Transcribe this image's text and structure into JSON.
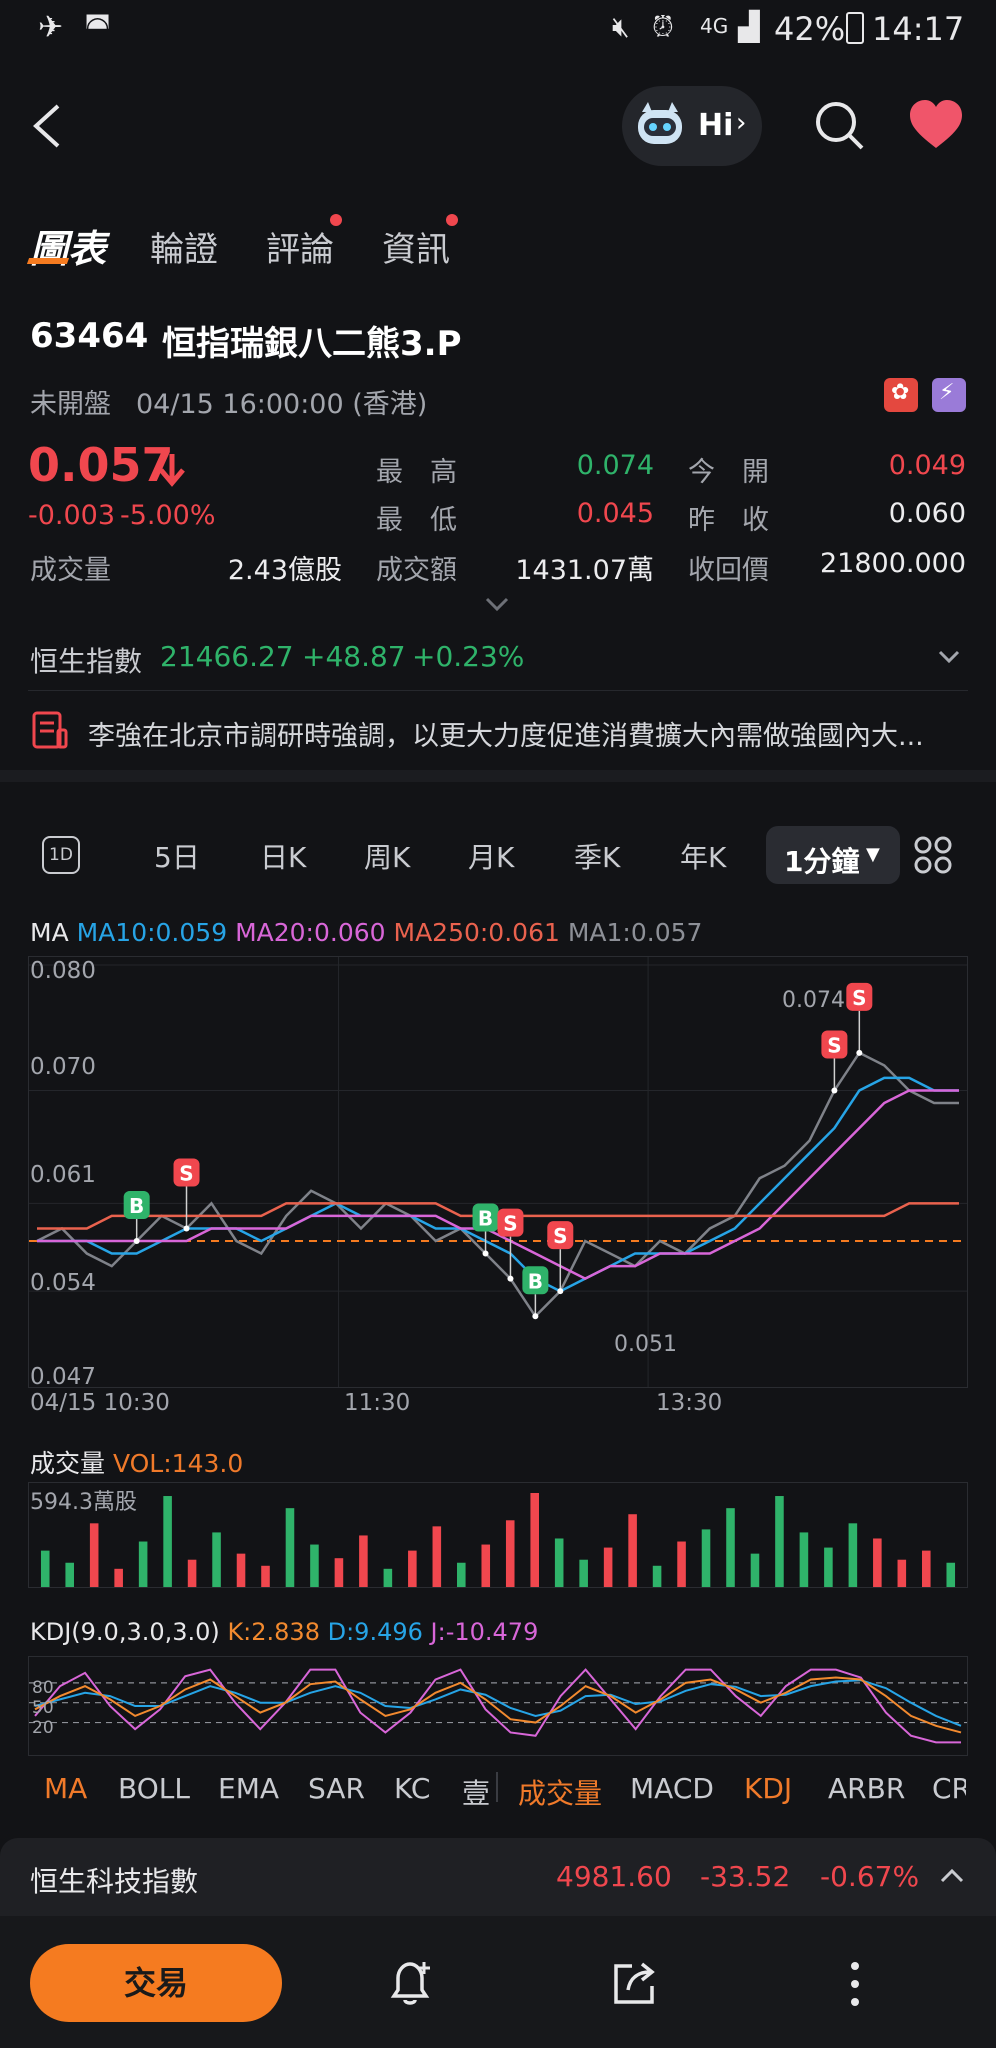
{
  "status": {
    "battery": "42%",
    "time": "14:17",
    "network": "4G"
  },
  "nav": {
    "hi_label": "Hi"
  },
  "tabs": [
    "圖表",
    "輪證",
    "評論",
    "資訊"
  ],
  "stock": {
    "code": "63464",
    "name": "恒指瑞銀八二熊3.P",
    "market_status": "未開盤",
    "datetime": "04/15 16:00:00 (香港)",
    "price": "0.057",
    "change": "-0.003",
    "change_pct": "-5.00%",
    "high_label": "最　高",
    "high": "0.074",
    "open_label": "今　開",
    "open": "0.049",
    "low_label": "最　低",
    "low": "0.045",
    "prev_label": "昨　收",
    "prev": "0.060",
    "volume_label": "成交量",
    "volume": "2.43億股",
    "turnover_label": "成交額",
    "turnover": "1431.07萬",
    "callprice_label": "收回價",
    "callprice": "21800.000"
  },
  "index": {
    "name": "恒生指數",
    "value": "21466.27",
    "change": "+48.87",
    "pct": "+0.23%"
  },
  "news": {
    "headline": "李強在北京市調研時強調，以更大力度促進消費擴大內需做強國內大..."
  },
  "periods": [
    "1D",
    "5日",
    "日K",
    "周K",
    "月K",
    "季K",
    "年K",
    "1分鐘"
  ],
  "ma_legend": {
    "ma": "MA",
    "ma10": "MA10:0.059",
    "ma20": "MA20:0.060",
    "ma250": "MA250:0.061",
    "ma1": "MA1:0.057"
  },
  "price_axis": [
    "0.080",
    "0.070",
    "0.061",
    "0.054",
    "0.047"
  ],
  "time_axis": [
    "04/15 10:30",
    "11:30",
    "13:30"
  ],
  "annotations": {
    "max_label": "0.074",
    "min_label": "0.051",
    "buy": "B",
    "sell": "S"
  },
  "volume_panel": {
    "title": "成交量",
    "vol": "VOL:143.0",
    "max": "594.3萬股"
  },
  "kdj_panel": {
    "title": "KDJ(9.0,3.0,3.0)",
    "k": "K:2.838",
    "d": "D:9.496",
    "j": "J:-10.479",
    "levels": [
      "80",
      "50",
      "20"
    ]
  },
  "indicator_tabs": [
    "MA",
    "BOLL",
    "EMA",
    "SAR",
    "KC",
    "壹",
    "成交量",
    "MACD",
    "KDJ",
    "ARBR",
    "CR"
  ],
  "bottom_index": {
    "name": "恒生科技指數",
    "value": "4981.60",
    "change": "-33.52",
    "pct": "-0.67%"
  },
  "bottom_bar": {
    "trade": "交易"
  },
  "colors": {
    "up": "#2fb36a",
    "down": "#f0474e",
    "accent": "#f57b20",
    "ma10": "#27a4e6",
    "ma20": "#d866d8",
    "ma250": "#e9624e"
  },
  "chart_data": {
    "type": "line",
    "title": "",
    "xlabel": "",
    "ylabel": "",
    "x_ticks": [
      "04/15 10:30",
      "11:30",
      "13:30"
    ],
    "ylim": [
      0.047,
      0.08
    ],
    "series": [
      {
        "name": "MA1",
        "values": [
          0.058,
          0.059,
          0.057,
          0.056,
          0.058,
          0.06,
          0.059,
          0.061,
          0.058,
          0.057,
          0.06,
          0.062,
          0.061,
          0.059,
          0.061,
          0.06,
          0.058,
          0.059,
          0.057,
          0.055,
          0.052,
          0.054,
          0.058,
          0.057,
          0.056,
          0.058,
          0.057,
          0.059,
          0.06,
          0.063,
          0.064,
          0.066,
          0.07,
          0.073,
          0.072,
          0.07,
          0.069,
          0.069
        ]
      },
      {
        "name": "MA10",
        "values": [
          0.058,
          0.058,
          0.058,
          0.057,
          0.057,
          0.058,
          0.059,
          0.059,
          0.059,
          0.058,
          0.059,
          0.06,
          0.061,
          0.06,
          0.06,
          0.06,
          0.059,
          0.059,
          0.058,
          0.057,
          0.055,
          0.054,
          0.055,
          0.056,
          0.057,
          0.057,
          0.057,
          0.058,
          0.059,
          0.061,
          0.063,
          0.065,
          0.067,
          0.07,
          0.071,
          0.071,
          0.07,
          0.07
        ]
      },
      {
        "name": "MA20",
        "values": [
          0.058,
          0.058,
          0.058,
          0.058,
          0.058,
          0.058,
          0.058,
          0.059,
          0.059,
          0.059,
          0.059,
          0.06,
          0.06,
          0.06,
          0.06,
          0.06,
          0.06,
          0.059,
          0.059,
          0.058,
          0.057,
          0.056,
          0.055,
          0.056,
          0.056,
          0.057,
          0.057,
          0.057,
          0.058,
          0.059,
          0.061,
          0.063,
          0.065,
          0.067,
          0.069,
          0.07,
          0.07,
          0.07
        ]
      },
      {
        "name": "MA250",
        "values": [
          0.059,
          0.059,
          0.059,
          0.06,
          0.06,
          0.06,
          0.06,
          0.06,
          0.06,
          0.06,
          0.061,
          0.061,
          0.061,
          0.061,
          0.061,
          0.061,
          0.061,
          0.06,
          0.06,
          0.06,
          0.06,
          0.06,
          0.06,
          0.06,
          0.06,
          0.06,
          0.06,
          0.06,
          0.06,
          0.06,
          0.06,
          0.06,
          0.06,
          0.06,
          0.06,
          0.061,
          0.061,
          0.061
        ]
      }
    ],
    "prev_close": 0.058,
    "markers": [
      {
        "type": "B",
        "i": 4
      },
      {
        "type": "S",
        "i": 6
      },
      {
        "type": "B",
        "i": 18
      },
      {
        "type": "S",
        "i": 21
      },
      {
        "type": "B",
        "i": 20
      },
      {
        "type": "S",
        "i": 19
      },
      {
        "type": "S",
        "i": 32
      },
      {
        "type": "S",
        "i": 33
      }
    ],
    "volume": [
      120,
      80,
      210,
      60,
      150,
      300,
      90,
      180,
      110,
      70,
      260,
      140,
      95,
      170,
      60,
      120,
      200,
      80,
      140,
      220,
      310,
      160,
      90,
      130,
      240,
      70,
      150,
      190,
      260,
      110,
      300,
      180,
      130,
      210,
      160,
      90,
      120,
      80
    ],
    "kdj": {
      "K": [
        40,
        60,
        75,
        55,
        30,
        45,
        70,
        85,
        60,
        35,
        50,
        78,
        82,
        55,
        30,
        40,
        65,
        80,
        55,
        25,
        20,
        45,
        75,
        60,
        35,
        55,
        80,
        85,
        70,
        50,
        65,
        85,
        88,
        85,
        60,
        30,
        15,
        5
      ],
      "D": [
        45,
        55,
        65,
        60,
        45,
        45,
        60,
        75,
        65,
        50,
        50,
        65,
        75,
        65,
        45,
        42,
        55,
        70,
        62,
        42,
        30,
        38,
        60,
        62,
        48,
        52,
        68,
        78,
        74,
        60,
        62,
        75,
        82,
        84,
        72,
        50,
        30,
        15
      ],
      "J": [
        30,
        75,
        95,
        45,
        10,
        40,
        90,
        100,
        50,
        10,
        50,
        100,
        100,
        35,
        5,
        35,
        85,
        100,
        40,
        5,
        0,
        60,
        100,
        55,
        10,
        60,
        100,
        100,
        60,
        30,
        75,
        100,
        100,
        88,
        35,
        0,
        -10,
        -10
      ]
    }
  }
}
